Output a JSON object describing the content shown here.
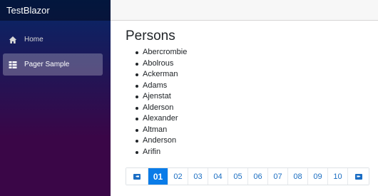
{
  "app": {
    "brand": "TestBlazor"
  },
  "sidebar": {
    "items": [
      {
        "label": "Home",
        "icon": "home-icon",
        "active": false
      },
      {
        "label": "Pager Sample",
        "icon": "list-icon",
        "active": true
      }
    ]
  },
  "main": {
    "title": "Persons",
    "persons": [
      "Abercrombie",
      "Abolrous",
      "Ackerman",
      "Adams",
      "Ajenstat",
      "Alderson",
      "Alexander",
      "Altman",
      "Anderson",
      "Arifin"
    ]
  },
  "pager": {
    "first_symbol": "◂◂",
    "last_symbol": "▸▸",
    "pages": [
      "01",
      "02",
      "03",
      "04",
      "05",
      "06",
      "07",
      "08",
      "09",
      "10"
    ],
    "active_page": "01",
    "accent_color": "#0a7ce8"
  }
}
